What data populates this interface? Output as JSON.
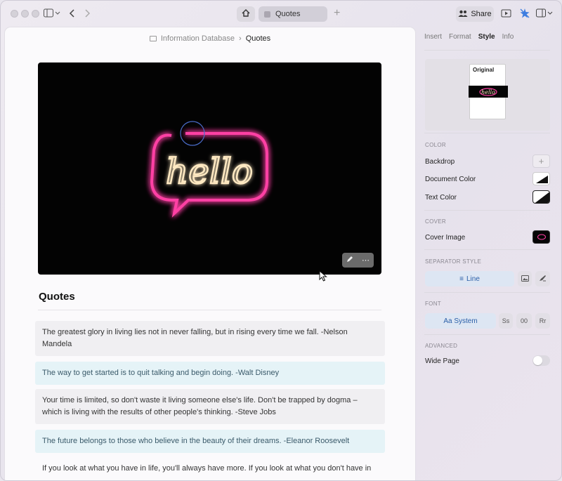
{
  "window": {
    "breadcrumb_root": "Information Database",
    "breadcrumb_current": "Quotes"
  },
  "titlebar": {
    "tab_label": "Quotes",
    "share_label": "Share"
  },
  "document": {
    "title": "Quotes",
    "cover_text": "hello",
    "quotes": [
      {
        "text": "The greatest glory in living lies not in never falling, but in rising every time we fall. -Nelson Mandela",
        "style": "grey"
      },
      {
        "text": "The way to get started is to quit talking and begin doing. -Walt Disney",
        "style": "blue"
      },
      {
        "text": "Your time is limited, so don't waste it living someone else's life. Don't be trapped by dogma – which is living with the results of other people's thinking. -Steve Jobs",
        "style": "grey"
      },
      {
        "text": "The future belongs to those who believe in the beauty of their dreams. -Eleanor Roosevelt",
        "style": "blue"
      },
      {
        "text": "If you look at what you have in life, you'll always have more. If you look at what you don't have in",
        "style": "plain"
      }
    ]
  },
  "sidebar": {
    "tabs": [
      "Insert",
      "Format",
      "Style",
      "Info"
    ],
    "active_tab": "Style",
    "preview_label": "Original",
    "sections": {
      "color": "COLOR",
      "cover": "COVER",
      "separator": "SEPARATOR STYLE",
      "font": "FONT",
      "advanced": "ADVANCED"
    },
    "color_rows": {
      "backdrop": "Backdrop",
      "document_color": "Document Color",
      "text_color": "Text Color"
    },
    "cover_row": "Cover Image",
    "separator_selected": "Line",
    "font_selected": "Aa System",
    "font_options": [
      "Ss",
      "00",
      "Rr"
    ],
    "advanced_row": "Wide Page",
    "wide_page_on": false
  },
  "colors": {
    "accent": "#2a5fa8",
    "neon_pink": "#ff3fa4",
    "neon_warm": "#ffe9c2"
  }
}
